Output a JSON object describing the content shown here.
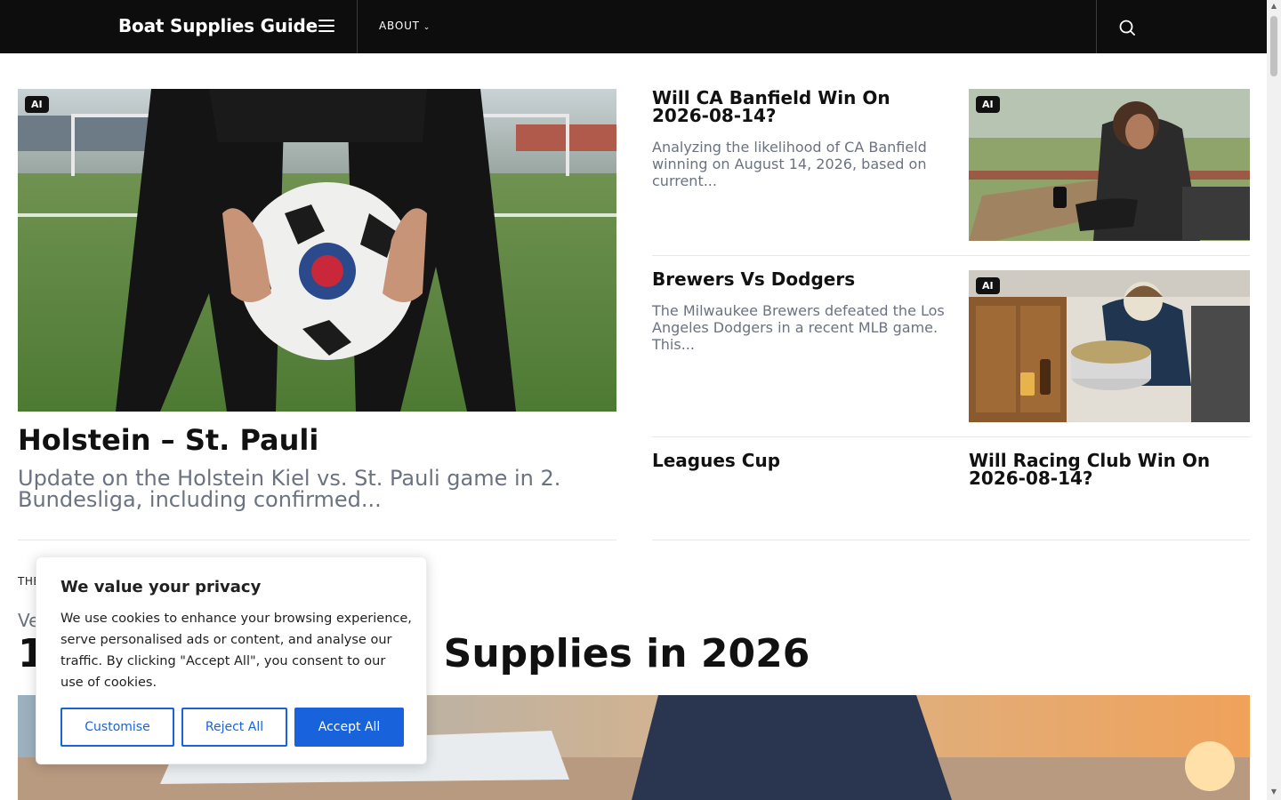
{
  "header": {
    "brand": "Boat Supplies Guide",
    "menu_icon": "hamburger-menu-icon",
    "nav_about": "ABOUT",
    "nav_about_icon": "chevron-down-icon",
    "search_icon": "search-icon"
  },
  "badge_label": "AI",
  "featured": {
    "title": "Holstein – St. Pauli",
    "excerpt": "Update on the Holstein Kiel vs. St. Pauli game in 2. Bundesliga, including confirmed..."
  },
  "side_posts": [
    {
      "title": "Will CA Banfield Win On 2026-08-14?",
      "excerpt": "Analyzing the likelihood of CA Banfield winning on August 14, 2026, based on current..."
    },
    {
      "title": "Brewers Vs Dodgers",
      "excerpt": "The Milwaukee Brewers defeated the Los Angeles Dodgers in a recent MLB game. This..."
    },
    {
      "title": "Leagues Cup",
      "excerpt": ""
    },
    {
      "title": "Will Racing Club Win On 2026-08-14?",
      "excerpt": ""
    }
  ],
  "section": {
    "label": "THE",
    "subtitle": "Ve",
    "title_start": "1",
    "title_end": "Supplies in 2026"
  },
  "cookie": {
    "title": "We value your privacy",
    "text": "We use cookies to enhance your browsing experience, serve personalised ads or content, and analyse our traffic. By clicking \"Accept All\", you consent to our use of cookies.",
    "customise": "Customise",
    "reject": "Reject All",
    "accept": "Accept All"
  },
  "colors": {
    "header_bg": "#0d0d0d",
    "accent_blue": "#1863dc",
    "excerpt_gray": "#6b7280"
  }
}
